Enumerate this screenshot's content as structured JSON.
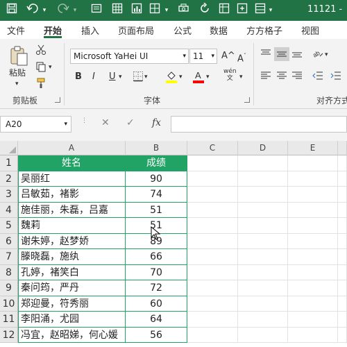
{
  "titlebar": {
    "filename": "11121 -",
    "bg_color": "#217346",
    "qat_icons": [
      "save-icon",
      "undo-icon",
      "undo-dropdown-icon",
      "redo-icon",
      "redo-dropdown-icon",
      "form-icon",
      "table-icon",
      "chart-icon",
      "dropdown-icon",
      "print-preview-icon",
      "redo-icon",
      "grid-icon"
    ]
  },
  "ribbon_tabs": {
    "items": [
      "文件",
      "开始",
      "插入",
      "页面布局",
      "公式",
      "数据",
      "方方格子",
      "视图"
    ],
    "active": "开始",
    "accent_color": "#217346"
  },
  "ribbon": {
    "clipboard": {
      "label": "剪贴板",
      "paste_label": "粘贴",
      "icons": [
        "paste-icon",
        "cut-icon",
        "copy-icon",
        "format-painter-icon"
      ]
    },
    "font": {
      "label": "字体",
      "font_name": "Microsoft YaHei UI",
      "font_size": "11",
      "bold": "B",
      "italic": "I",
      "underline": "U",
      "grow_label": "A^",
      "shrink_label": "A",
      "fill_color": "#ffff00",
      "font_color": "#ff0000",
      "phonetic_label": "wén",
      "icons": [
        "borders-icon",
        "fill-color-icon",
        "font-color-icon",
        "phonetic-icon"
      ]
    },
    "alignment": {
      "label": "对齐方式",
      "icons": [
        "align-top-icon",
        "align-middle-icon",
        "align-bottom-icon",
        "orientation-icon",
        "align-left-icon",
        "align-center-icon",
        "align-right-icon",
        "decrease-indent-icon",
        "increase-indent-icon"
      ]
    }
  },
  "formula_bar": {
    "name_box": "A20",
    "cancel_icon": "✕",
    "enter_icon": "✓",
    "fx_label": "fx",
    "formula": ""
  },
  "grid": {
    "columns": [
      "A",
      "B",
      "C",
      "D",
      "E"
    ],
    "rows": [
      "1",
      "2",
      "3",
      "4",
      "5",
      "6",
      "7",
      "8",
      "9",
      "10",
      "11",
      "12"
    ],
    "header": {
      "name": "姓名",
      "score": "成绩"
    },
    "records": [
      {
        "name": "吴丽红",
        "score": "90"
      },
      {
        "name": "吕敏茹，褚影",
        "score": "74"
      },
      {
        "name": "施佳丽，朱磊，吕嘉",
        "score": "51"
      },
      {
        "name": "魏莉",
        "score": "51"
      },
      {
        "name": "谢朱婷，赵梦娇",
        "score": "89"
      },
      {
        "name": "滕晓磊，施纨",
        "score": "66"
      },
      {
        "name": "孔婷，褚笑白",
        "score": "70"
      },
      {
        "name": "秦问筠，严丹",
        "score": "72"
      },
      {
        "name": "郑迎曼，符秀丽",
        "score": "60"
      },
      {
        "name": "李阳涌，尤园",
        "score": "64"
      },
      {
        "name": "冯宜，赵昭娣，何心媛",
        "score": "56"
      }
    ],
    "table_color": "#21a366"
  }
}
